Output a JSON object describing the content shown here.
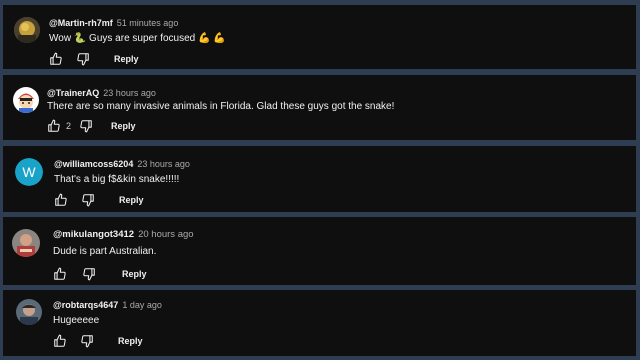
{
  "comments": [
    {
      "handle": "@Martin-rh7mf",
      "time": "51 minutes ago",
      "text_before": "Wow ",
      "emoji_snake": "🐍",
      "text_after": " Guys are super focused ",
      "emoji_muscles": "💪 💪",
      "likes": "",
      "reply_label": "Reply",
      "avatar": "photo-avatar"
    },
    {
      "handle": "@TrainerAQ",
      "time": "23 hours ago",
      "text": "There are so many invasive animals in Florida. Glad these guys got the snake!",
      "likes": "2",
      "reply_label": "Reply",
      "avatar": "cartoon-avatar"
    },
    {
      "handle": "@williamcoss6204",
      "time": "23 hours ago",
      "text": "That's a big f$&kin snake!!!!!",
      "likes": "",
      "reply_label": "Reply",
      "avatar_letter": "W",
      "avatar_color": "#1aa3c9"
    },
    {
      "handle": "@mikulangot3412",
      "time": "20 hours ago",
      "text": "Dude is part Australian.",
      "likes": "",
      "reply_label": "Reply",
      "avatar": "photo-avatar"
    },
    {
      "handle": "@robtarqs4647",
      "time": "1 day ago",
      "text": "Hugeeeee",
      "likes": "",
      "reply_label": "Reply",
      "avatar": "photo-avatar"
    }
  ],
  "icons": {
    "like": "thumbs-up-icon",
    "dislike": "thumbs-down-icon"
  },
  "colors": {
    "page_bg": "#2f3d52",
    "card_bg": "#0f0f10",
    "text": "#f1f1f1",
    "muted": "#aaaaaa"
  }
}
